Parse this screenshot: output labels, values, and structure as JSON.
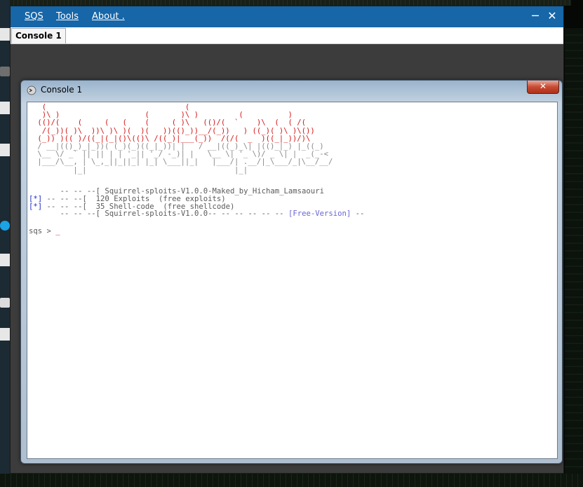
{
  "menu": {
    "items": [
      {
        "label": "SQS"
      },
      {
        "label": "Tools"
      },
      {
        "label": "About ."
      }
    ]
  },
  "window_controls": {
    "minimize": "─",
    "close": "✕"
  },
  "tabs": [
    {
      "label": "Console 1"
    }
  ],
  "console_window": {
    "title": "Console 1",
    "close_label": "✕"
  },
  "console": {
    "banner_line1": "       -- -- --[ Squirrel-sploits-V1.0.0-Maked_by_Hicham_Lamsaouri",
    "line2_star": "[*]",
    "line2_text": " -- -- --[  120 Exploits  (free exploits)",
    "line3_star": "[*]",
    "line3_text": " -- -- --[  35 Shell-code  (free shellcode)",
    "line4_text": "       -- -- --[ Squirrel-sploits-V1.0.0-- -- -- -- -- -- ",
    "line4_free": "[Free-Version]",
    "line4_end": " --",
    "prompt": "sqs > ",
    "cursor": "_"
  },
  "colors": {
    "menubar": "#1666a8",
    "ascii_red": "#d31616",
    "star_blue": "#1b2fc9",
    "free_version": "#6a64d6"
  },
  "icons": {
    "console_icon": "console-window-icon"
  }
}
